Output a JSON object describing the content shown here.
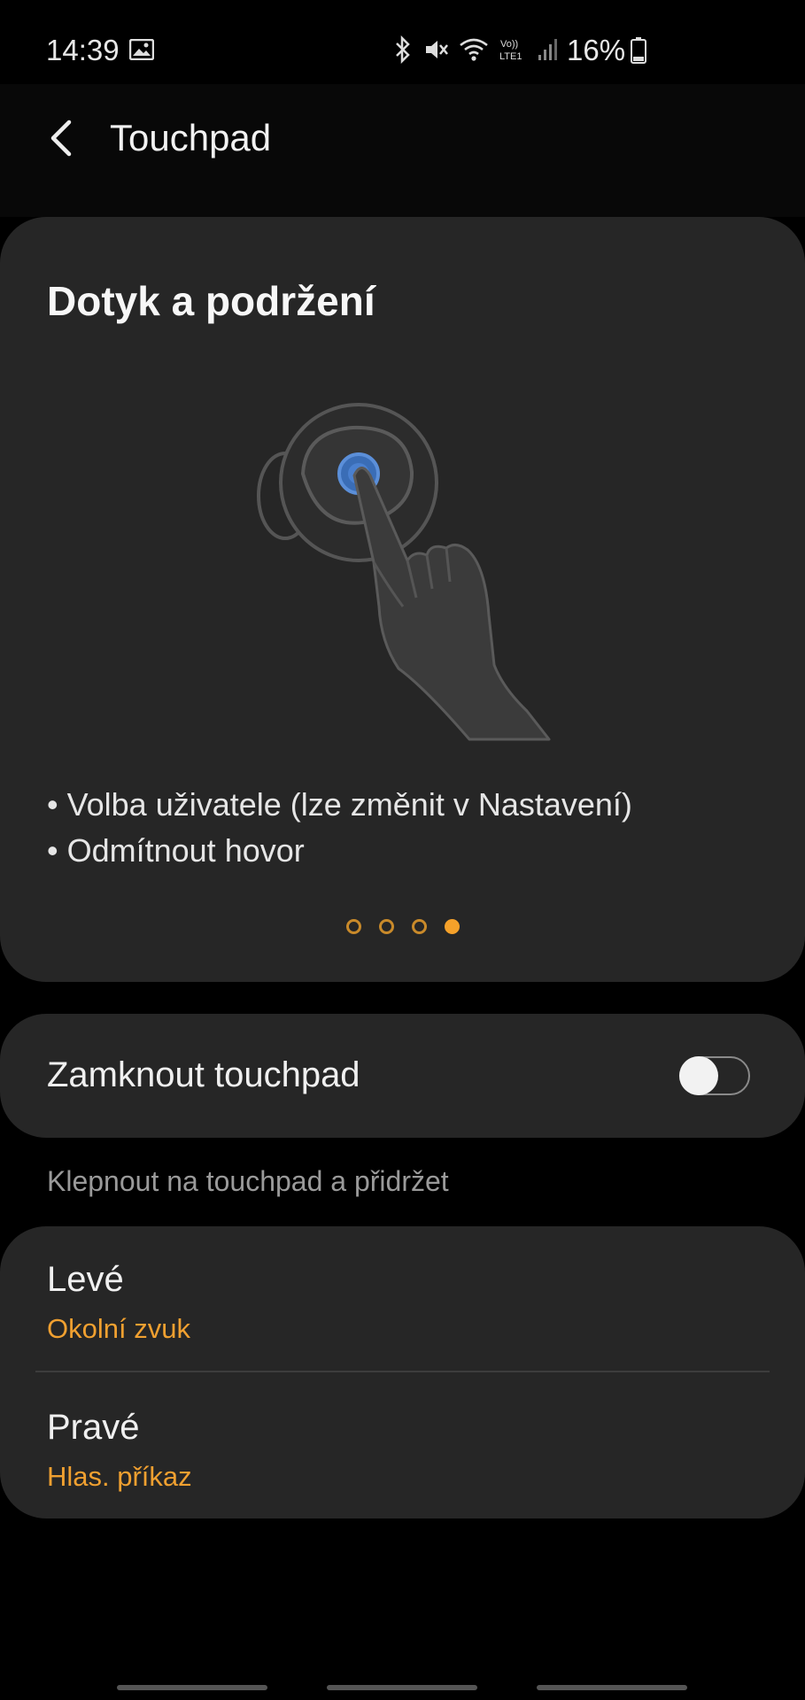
{
  "status": {
    "time": "14:39",
    "battery": "16%",
    "icons": [
      "gallery-icon",
      "bluetooth-icon",
      "mute-icon",
      "wifi-icon",
      "volte-icon",
      "signal-icon",
      "battery-icon"
    ]
  },
  "header": {
    "title": "Touchpad"
  },
  "tutorial": {
    "title": "Dotyk a podržení",
    "bullets": [
      "• Volba uživatele (lze změnit v Nastavení)",
      "• Odmítnout hovor"
    ],
    "page": 4,
    "pages": 4
  },
  "lock": {
    "label": "Zamknout touchpad",
    "enabled": false
  },
  "section": {
    "label": "Klepnout na touchpad a přidržet"
  },
  "sides": {
    "left": {
      "title": "Levé",
      "value": "Okolní zvuk"
    },
    "right": {
      "title": "Pravé",
      "value": "Hlas. příkaz"
    }
  },
  "colors": {
    "accent": "#f0a030",
    "card": "#262626",
    "background": "#000000"
  }
}
